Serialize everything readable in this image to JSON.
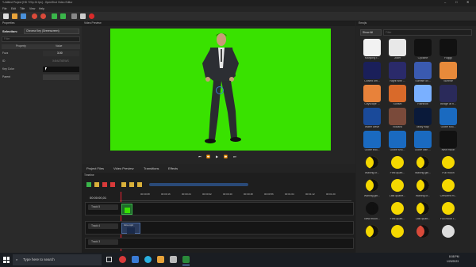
{
  "window": {
    "title": "*Untitled Project [HD 720p 24 fps] - OpenShot Video Editor",
    "controls": [
      "–",
      "□",
      "✕"
    ]
  },
  "menu": [
    "File",
    "Edit",
    "Title",
    "View",
    "Help"
  ],
  "toolbar": {
    "icons": [
      "new-project-icon",
      "open-project-icon",
      "save-project-icon",
      "undo-icon",
      "redo-icon",
      "import-files-icon",
      "add-track-icon",
      "profile-icon",
      "fullscreen-icon",
      "export-video-icon"
    ]
  },
  "properties": {
    "header": "Properties",
    "selection_label": "Selection:",
    "selection_value": "Chroma Key (Greenscreen)",
    "filter_placeholder": "Filter",
    "columns": [
      "Property",
      "Value"
    ],
    "rows": [
      {
        "property": "Fuzz",
        "value": "3.00"
      },
      {
        "property": "ID",
        "value": "X4NUT6EWS"
      },
      {
        "property": "Key Color",
        "value": ""
      },
      {
        "property": "Parent",
        "value": ""
      }
    ]
  },
  "preview": {
    "header": "Video Preview",
    "buttons": [
      "jump-start-icon",
      "rewind-icon",
      "play-icon",
      "fast-forward-icon",
      "jump-end-icon"
    ]
  },
  "bottom_tabs": [
    "Project Files",
    "Video Preview",
    "Transitions",
    "Effects"
  ],
  "timeline": {
    "header": "Timeline",
    "timecode": "00:00:00,01",
    "ruler": [
      "00:00:08",
      "00:00:16",
      "00:00:24",
      "00:00:32",
      "00:00:40",
      "00:00:48",
      "00:00:56",
      "00:01:04",
      "00:01:12",
      "00:01:20",
      "00:01:28"
    ],
    "tracks": [
      {
        "label": "Track 5",
        "clip": ""
      },
      {
        "label": "Track 4",
        "clip": "Intro.mp4"
      },
      {
        "label": "Track 3",
        "clip": ""
      }
    ]
  },
  "emoji_panel": {
    "header": "Emojis",
    "show_label": "Show All",
    "filter_placeholder": "Filter",
    "rows": [
      [
        "Mahjong r...",
        "Joker",
        "Cyclone",
        "Foggy"
      ],
      [
        "Closed um...",
        "Night with ...",
        "Sunrise ov...",
        "Sunrise"
      ],
      [
        "Cityscape ...",
        "Sunset",
        "Rainbow",
        "Bridge at n..."
      ],
      [
        "Water wave",
        "Volcano",
        "Milky way",
        "Globe sho..."
      ],
      [
        "Globe sho...",
        "Globe sho...",
        "Globe with ...",
        "New moon"
      ],
      [
        "Waxing cr...",
        "First quart...",
        "Waxing gib...",
        "Full moon"
      ],
      [
        "Waning gib...",
        "Last quarte...",
        "Waning cr...",
        "Crescent m..."
      ],
      [
        "New moon...",
        "First quart...",
        "Last quart...",
        "Full moon f..."
      ],
      [
        "",
        "",
        "",
        ""
      ]
    ]
  },
  "taskbar": {
    "search_placeholder": "Type here to search",
    "time": "8:08 PM",
    "date": "1/20/2023"
  },
  "colors": {
    "greenscreen": "#39e200",
    "accent": "#3a7bd5"
  }
}
